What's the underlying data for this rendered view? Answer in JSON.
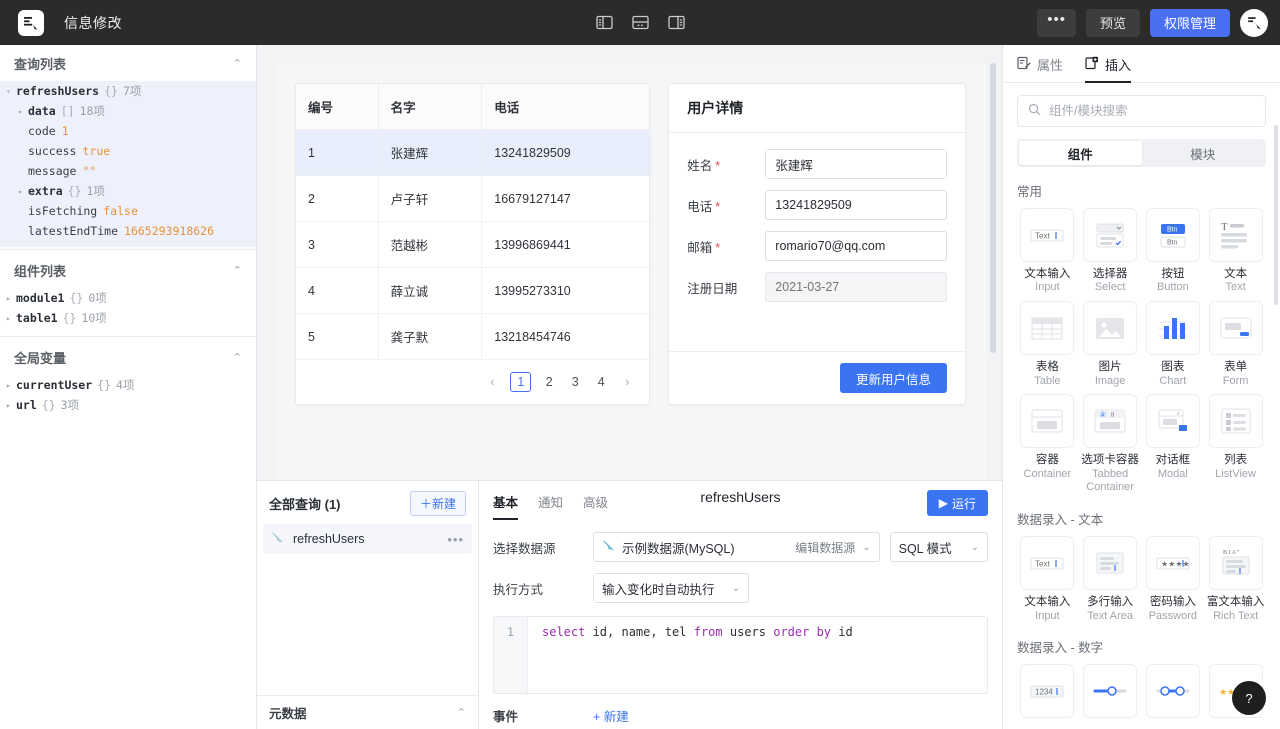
{
  "header": {
    "title": "信息修改",
    "logo_icon": "app-logo-icon",
    "panel_toggles": [
      {
        "name": "toggle-left-panel-icon"
      },
      {
        "name": "toggle-bottom-panel-icon"
      },
      {
        "name": "toggle-right-panel-icon"
      }
    ],
    "more_label": "•••",
    "preview_label": "预览",
    "permission_label": "权限管理",
    "avatar_icon": "user-avatar-icon",
    "accent": "#4a6ff0"
  },
  "left": {
    "sections": [
      {
        "title": "查询列表",
        "caret": "⌃",
        "nodes": [
          {
            "indent": 0,
            "arrow": "▾",
            "key": "refreshUsers",
            "brace": "{}",
            "count": "7项",
            "value": "",
            "bold": true
          },
          {
            "indent": 1,
            "arrow": "▸",
            "key": "data",
            "brace": "[]",
            "count": "18项",
            "value": "",
            "bold": true
          },
          {
            "indent": 1,
            "arrow": "",
            "key": "code",
            "brace": "",
            "count": "",
            "value": "1",
            "bold": false
          },
          {
            "indent": 1,
            "arrow": "",
            "key": "success",
            "brace": "",
            "count": "",
            "value": "true",
            "bold": false
          },
          {
            "indent": 1,
            "arrow": "",
            "key": "message",
            "brace": "",
            "count": "",
            "value": "\"\"",
            "bold": false
          },
          {
            "indent": 1,
            "arrow": "▸",
            "key": "extra",
            "brace": "{}",
            "count": "1项",
            "value": "",
            "bold": true
          },
          {
            "indent": 1,
            "arrow": "",
            "key": "isFetching",
            "brace": "",
            "count": "",
            "value": "false",
            "bold": false
          },
          {
            "indent": 1,
            "arrow": "",
            "key": "latestEndTime",
            "brace": "",
            "count": "",
            "value": "1665293918626",
            "bold": false
          }
        ]
      },
      {
        "title": "组件列表",
        "caret": "⌃",
        "nodes": [
          {
            "indent": 0,
            "arrow": "▸",
            "key": "module1",
            "brace": "{}",
            "count": "0项",
            "value": "",
            "bold": true
          },
          {
            "indent": 0,
            "arrow": "▸",
            "key": "table1",
            "brace": "{}",
            "count": "10项",
            "value": "",
            "bold": true
          }
        ]
      },
      {
        "title": "全局变量",
        "caret": "⌃",
        "nodes": [
          {
            "indent": 0,
            "arrow": "▸",
            "key": "currentUser",
            "brace": "{}",
            "count": "4项",
            "value": "",
            "bold": true
          },
          {
            "indent": 0,
            "arrow": "▸",
            "key": "url",
            "brace": "{}",
            "count": "3项",
            "value": "",
            "bold": true
          }
        ]
      }
    ]
  },
  "canvas": {
    "table": {
      "columns": [
        "编号",
        "名字",
        "电话"
      ],
      "rows": [
        {
          "id": "1",
          "name": "张建辉",
          "tel": "13241829509",
          "selected": true
        },
        {
          "id": "2",
          "name": "卢子轩",
          "tel": "16679127147",
          "selected": false
        },
        {
          "id": "3",
          "name": "范越彬",
          "tel": "13996869441",
          "selected": false
        },
        {
          "id": "4",
          "name": "薛立诚",
          "tel": "13995273310",
          "selected": false
        },
        {
          "id": "5",
          "name": "龚子默",
          "tel": "13218454746",
          "selected": false
        }
      ],
      "pagination": {
        "prev": "‹",
        "pages": [
          "1",
          "2",
          "3",
          "4"
        ],
        "current": "1",
        "next": "›"
      }
    },
    "form": {
      "title": "用户详情",
      "fields": [
        {
          "label": "姓名",
          "required": true,
          "value": "张建辉",
          "placeholder": "",
          "disabled": false
        },
        {
          "label": "电话",
          "required": true,
          "value": "13241829509",
          "placeholder": "",
          "disabled": false
        },
        {
          "label": "邮箱",
          "required": true,
          "value": "romario70@qq.com",
          "placeholder": "",
          "disabled": false
        },
        {
          "label": "注册日期",
          "required": false,
          "value": "",
          "placeholder": "2021-03-27",
          "disabled": true
        }
      ],
      "submit_label": "更新用户信息"
    }
  },
  "query_list": {
    "title": "全部查询 (1)",
    "new_label": "＋新建",
    "items": [
      {
        "name": "refreshUsers",
        "icon": "query-mysql-icon",
        "more": "•••"
      }
    ],
    "meta_title": "元数据",
    "meta_caret": "⌃"
  },
  "query_detail": {
    "tabs": [
      {
        "label": "基本",
        "active": true
      },
      {
        "label": "通知",
        "active": false
      },
      {
        "label": "高级",
        "active": false
      }
    ],
    "name": "refreshUsers",
    "run_label": "运行",
    "run_icon": "play-icon",
    "datasource_label": "选择数据源",
    "datasource_value": "示例数据源(MySQL)",
    "datasource_edit": "编辑数据源",
    "mode_value": "SQL 模式",
    "exec_label": "执行方式",
    "exec_value": "输入变化时自动执行",
    "sql_line_number": "1",
    "sql_tokens": [
      {
        "t": "select",
        "kw": true
      },
      {
        "t": " id, name, tel ",
        "kw": false
      },
      {
        "t": "from",
        "kw": true
      },
      {
        "t": " users ",
        "kw": false
      },
      {
        "t": "order by",
        "kw": true
      },
      {
        "t": " id",
        "kw": false
      }
    ],
    "event_label": "事件",
    "event_new": "+ 新建"
  },
  "right": {
    "tabs": [
      {
        "label": "属性",
        "icon": "properties-icon",
        "active": false
      },
      {
        "label": "插入",
        "icon": "insert-icon",
        "active": true
      }
    ],
    "search_placeholder": "组件/模块搜索",
    "search_value": "",
    "segments": [
      {
        "label": "组件",
        "active": true
      },
      {
        "label": "模块",
        "active": false
      }
    ],
    "groups": [
      {
        "title": "常用",
        "items": [
          {
            "cn": "文本输入",
            "en": "Input",
            "icon": "input-tile-icon"
          },
          {
            "cn": "选择器",
            "en": "Select",
            "icon": "select-tile-icon"
          },
          {
            "cn": "按钮",
            "en": "Button",
            "icon": "button-tile-icon"
          },
          {
            "cn": "文本",
            "en": "Text",
            "icon": "text-tile-icon"
          },
          {
            "cn": "表格",
            "en": "Table",
            "icon": "table-tile-icon"
          },
          {
            "cn": "图片",
            "en": "Image",
            "icon": "image-tile-icon"
          },
          {
            "cn": "图表",
            "en": "Chart",
            "icon": "chart-tile-icon"
          },
          {
            "cn": "表单",
            "en": "Form",
            "icon": "form-tile-icon"
          },
          {
            "cn": "容器",
            "en": "Container",
            "icon": "container-tile-icon"
          },
          {
            "cn": "选项卡容器",
            "en": "Tabbed Container",
            "icon": "tabbed-container-tile-icon"
          },
          {
            "cn": "对话框",
            "en": "Modal",
            "icon": "modal-tile-icon"
          },
          {
            "cn": "列表",
            "en": "ListView",
            "icon": "listview-tile-icon"
          }
        ]
      },
      {
        "title": "数据录入 - 文本",
        "items": [
          {
            "cn": "文本输入",
            "en": "Input",
            "icon": "input-tile-icon"
          },
          {
            "cn": "多行输入",
            "en": "Text Area",
            "icon": "textarea-tile-icon"
          },
          {
            "cn": "密码输入",
            "en": "Password",
            "icon": "password-tile-icon"
          },
          {
            "cn": "富文本输入",
            "en": "Rich Text",
            "icon": "richtext-tile-icon"
          }
        ]
      },
      {
        "title": "数据录入 - 数字",
        "items": [
          {
            "cn": "",
            "en": "",
            "icon": "number-input-tile-icon"
          },
          {
            "cn": "",
            "en": "",
            "icon": "slider-tile-icon"
          },
          {
            "cn": "",
            "en": "",
            "icon": "range-slider-tile-icon"
          },
          {
            "cn": "",
            "en": "",
            "icon": "rating-tile-icon"
          }
        ]
      }
    ],
    "help_label": "?"
  }
}
